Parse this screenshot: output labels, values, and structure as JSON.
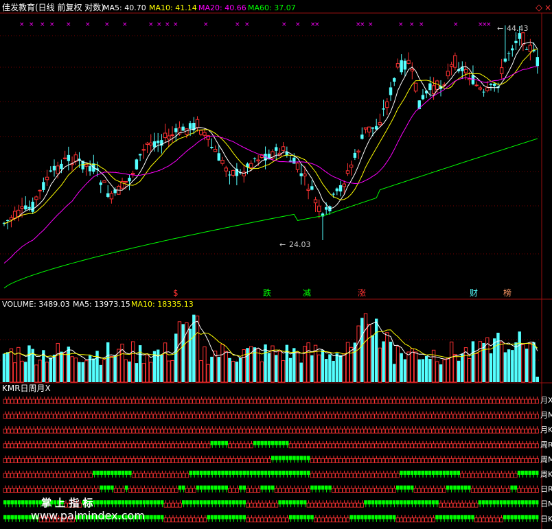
{
  "header": {
    "title": "佳发教育(日线 前复权 对数)",
    "ma_items": [
      {
        "label": "MA5: 40.70",
        "color": "#ffffff"
      },
      {
        "label": "MA10: 41.14",
        "color": "#ffff00"
      },
      {
        "label": "MA20: 40.66",
        "color": "#ff00ff"
      },
      {
        "label": "MA60: 37.07",
        "color": "#00ff00"
      }
    ],
    "window_icon": "diamond-icon"
  },
  "colors": {
    "up": "#ff3232",
    "down": "#54ffff",
    "ma5": "#ffffff",
    "ma10": "#ffff00",
    "ma20": "#ff00ff",
    "ma60": "#00ff00",
    "grid": "#7a0000",
    "frame": "#9a1010"
  },
  "annotations": {
    "high_label": "44.43",
    "low_label": "24.03",
    "markers": [
      {
        "text": "$",
        "color": "#ff3232"
      },
      {
        "text": "跌",
        "color": "#00ff00"
      },
      {
        "text": "减",
        "color": "#00ff00"
      },
      {
        "text": "涨",
        "color": "#ff3232"
      },
      {
        "text": "财",
        "color": "#54ffff"
      },
      {
        "text": "榜",
        "color": "#ff9966"
      }
    ]
  },
  "volume_header": {
    "items": [
      {
        "label": "VOLUME: 3489.03",
        "color": "#ffffff"
      },
      {
        "label": "MA5: 13973.15",
        "color": "#ffffff"
      },
      {
        "label": "MA10: 18335.13",
        "color": "#ffff00"
      }
    ]
  },
  "indicator": {
    "title": "KMR日周月X",
    "rows": [
      {
        "label": "月X"
      },
      {
        "label": "月M"
      },
      {
        "label": "月K"
      },
      {
        "label": "周R"
      },
      {
        "label": "周M"
      },
      {
        "label": "周K"
      },
      {
        "label": "日R"
      },
      {
        "label": "日M"
      },
      {
        "label": "日K"
      }
    ]
  },
  "watermark": {
    "line1": "掌 上 指 标",
    "line2": "www.palmindex.com"
  },
  "chart_data": {
    "type": "candlestick",
    "scale": "log",
    "price_high": 44.43,
    "price_low": 24.03,
    "ma_legend": [
      "MA5",
      "MA10",
      "MA20",
      "MA60"
    ],
    "volume_last": 3489.03,
    "volume_ma5": 13973.15,
    "volume_ma10": 18335.13
  }
}
